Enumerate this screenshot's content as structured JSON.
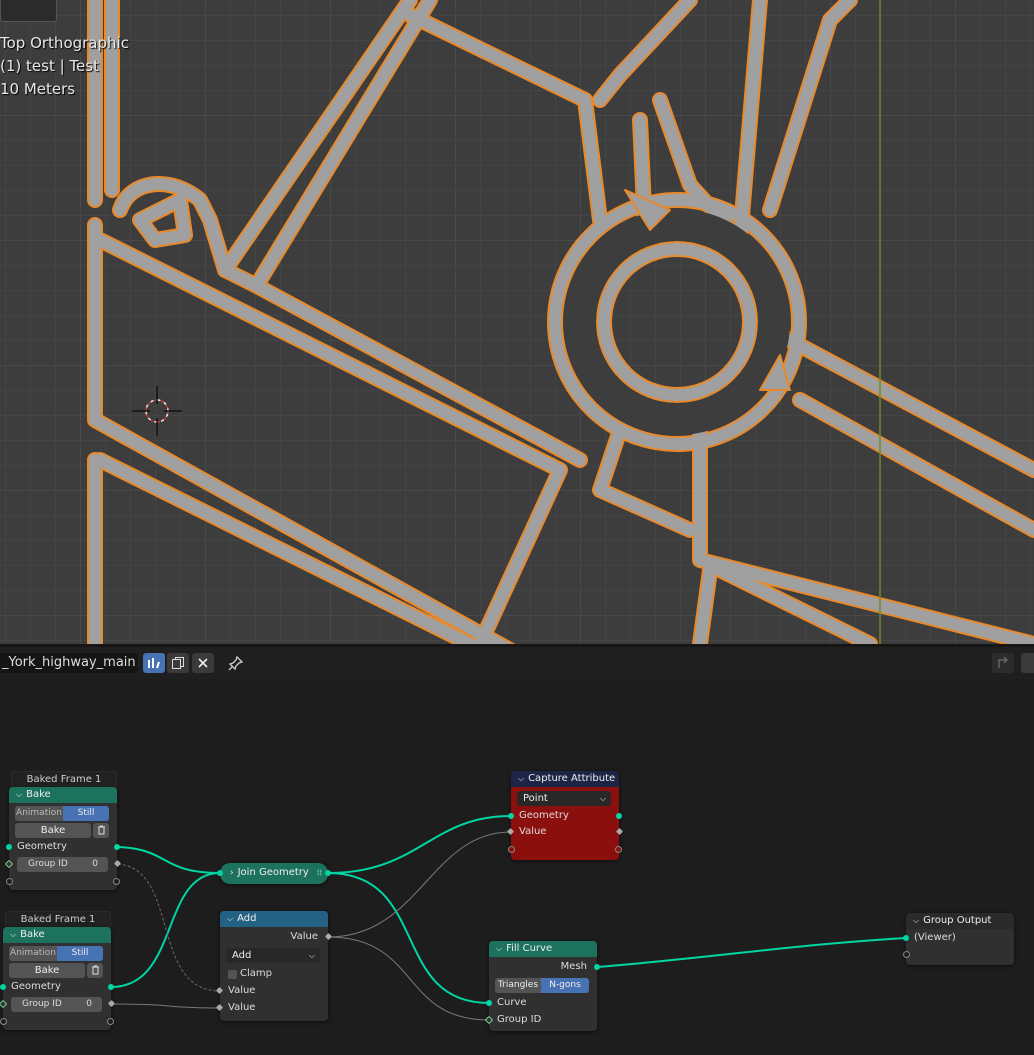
{
  "viewport": {
    "view_name": "Top Orthographic",
    "object_info": "(1) test | Test",
    "scale": "10 Meters"
  },
  "header": {
    "tree_name": "_York_highway_main",
    "icons": [
      "node-tree-icon",
      "duplicate-icon",
      "close-icon",
      "pin-icon",
      "parent-icon"
    ]
  },
  "nodes": {
    "frame1": {
      "label": "Baked Frame 1",
      "title": "Bake",
      "mode_options": [
        "Animation",
        "Still"
      ],
      "mode_selected": "Still",
      "bake_label": "Bake",
      "output_geometry": "Geometry",
      "group_id_label": "Group ID",
      "group_id_value": "0"
    },
    "frame2": {
      "label": "Baked Frame 1",
      "title": "Bake",
      "mode_options": [
        "Animation",
        "Still"
      ],
      "mode_selected": "Still",
      "bake_label": "Bake",
      "output_geometry": "Geometry",
      "group_id_label": "Group ID",
      "group_id_value": "0"
    },
    "join": {
      "title": "Join Geometry"
    },
    "add": {
      "title": "Add",
      "output": "Value",
      "operation": "Add",
      "clamp_label": "Clamp",
      "input1": "Value",
      "input2": "Value"
    },
    "capture": {
      "title": "Capture Attribute",
      "domain": "Point",
      "socket_geometry": "Geometry",
      "socket_value": "Value"
    },
    "fill": {
      "title": "Fill Curve",
      "output": "Mesh",
      "mode_options": [
        "Triangles",
        "N-gons"
      ],
      "mode_selected": "N-gons",
      "input_curve": "Curve",
      "input_group": "Group ID"
    },
    "output": {
      "title": "Group Output",
      "input": "(Viewer)"
    }
  },
  "colors": {
    "geometry_header": "#1d725e",
    "math_header": "#246283",
    "attribute_header": "#1d2546",
    "selected_node": "#8b0f0c",
    "geometry_socket": "#00d6a3",
    "selection_outline": "#f08a24"
  }
}
